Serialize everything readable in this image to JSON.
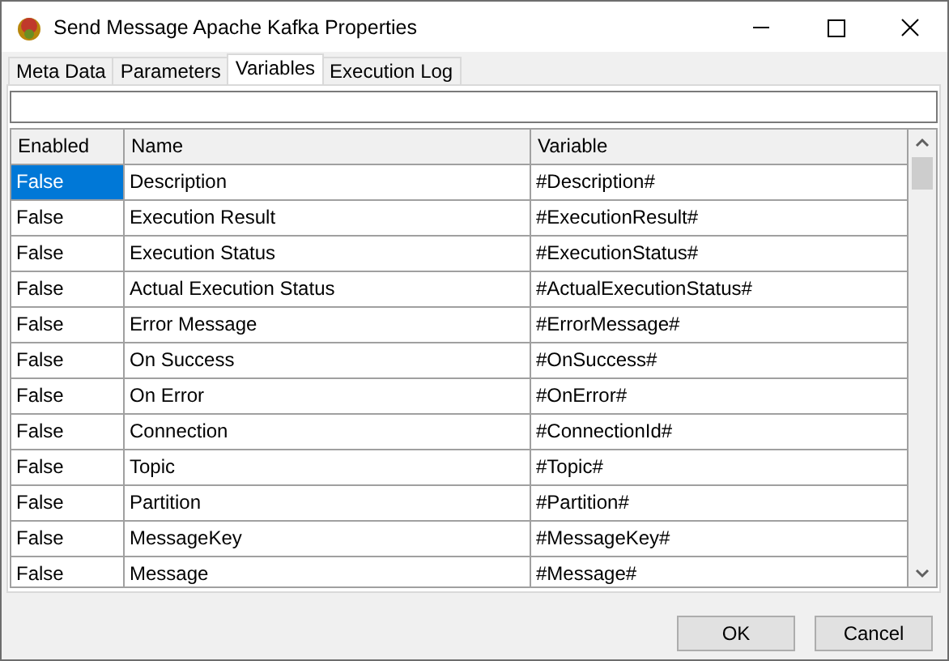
{
  "window": {
    "title": "Send Message Apache Kafka Properties"
  },
  "tabs": [
    {
      "label": "Meta Data",
      "selected": false
    },
    {
      "label": "Parameters",
      "selected": false
    },
    {
      "label": "Variables",
      "selected": true
    },
    {
      "label": "Execution Log",
      "selected": false
    }
  ],
  "table": {
    "columns": [
      "Enabled",
      "Name",
      "Variable"
    ],
    "rows": [
      {
        "enabled": "False",
        "name": "Description",
        "variable": "#Description#",
        "selected": true
      },
      {
        "enabled": "False",
        "name": "Execution Result",
        "variable": "#ExecutionResult#",
        "selected": false
      },
      {
        "enabled": "False",
        "name": "Execution Status",
        "variable": "#ExecutionStatus#",
        "selected": false
      },
      {
        "enabled": "False",
        "name": "Actual Execution Status",
        "variable": "#ActualExecutionStatus#",
        "selected": false
      },
      {
        "enabled": "False",
        "name": "Error Message",
        "variable": "#ErrorMessage#",
        "selected": false
      },
      {
        "enabled": "False",
        "name": "On Success",
        "variable": "#OnSuccess#",
        "selected": false
      },
      {
        "enabled": "False",
        "name": "On Error",
        "variable": "#OnError#",
        "selected": false
      },
      {
        "enabled": "False",
        "name": "Connection",
        "variable": "#ConnectionId#",
        "selected": false
      },
      {
        "enabled": "False",
        "name": "Topic",
        "variable": "#Topic#",
        "selected": false
      },
      {
        "enabled": "False",
        "name": "Partition",
        "variable": "#Partition#",
        "selected": false
      },
      {
        "enabled": "False",
        "name": "MessageKey",
        "variable": "#MessageKey#",
        "selected": false
      },
      {
        "enabled": "False",
        "name": "Message",
        "variable": "#Message#",
        "selected": false
      }
    ]
  },
  "buttons": [
    "OK",
    "Cancel"
  ]
}
